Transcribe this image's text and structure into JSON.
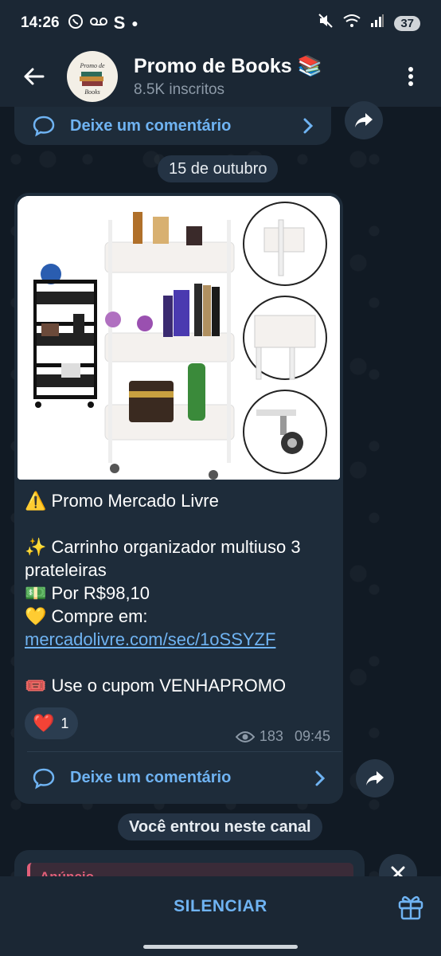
{
  "status_bar": {
    "time": "14:26",
    "left_icons": [
      "whatsapp-icon",
      "voicemail-icon",
      "s-app-icon",
      "dot-icon"
    ],
    "battery": "37"
  },
  "header": {
    "title": "Promo de Books 📚",
    "subtitle": "8.5K inscritos",
    "avatar_text": "Promo de Books"
  },
  "top_comment": {
    "label": "Deixe um comentário"
  },
  "date_pill": "15 de outubro",
  "message": {
    "line1": "⚠️ Promo Mercado Livre",
    "line2": "✨ Carrinho organizador multiuso 3 prateleiras",
    "line3": "💵 Por R$98,10",
    "line4_prefix": "💛 Compre em: ",
    "line4_link": "mercadolivre.com/sec/1oSSYZF",
    "line5": "🎟️ Use o cupom VENHAPROMO",
    "reaction_emoji": "❤️",
    "reaction_count": "1",
    "views": "183",
    "time": "09:45",
    "comment_label": "Deixe um comentário"
  },
  "joined_pill": "Você entrou neste canal",
  "ad": {
    "label": "Anúncio"
  },
  "bottom": {
    "mute_label": "SILENCIAR"
  },
  "colors": {
    "accent": "#6fb3f2",
    "background": "#0e1621",
    "bubble": "#1e2c3a",
    "header": "#1b2734"
  }
}
